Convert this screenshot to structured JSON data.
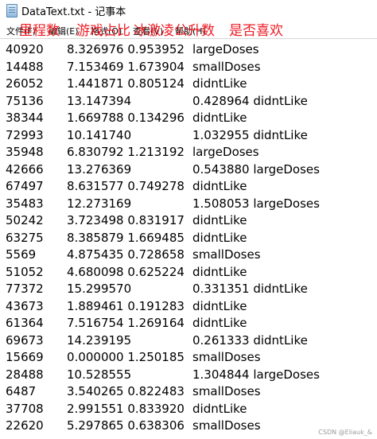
{
  "window": {
    "title": "DataText.txt - 记事本"
  },
  "menu": [
    "文件(F)",
    "编辑(E)",
    "格式(O)",
    "查看(V)",
    "帮助(H)"
  ],
  "annotations": [
    "里程数",
    "游戏占比",
    "冰激凌公升数",
    "是否喜欢"
  ],
  "rows": [
    [
      "40920",
      "8.326976 0.953952",
      "largeDoses"
    ],
    [
      "14488",
      "7.153469 1.673904",
      "smallDoses"
    ],
    [
      "26052",
      "1.441871 0.805124",
      "didntLike"
    ],
    [
      "75136",
      "13.147394",
      "0.428964 didntLike"
    ],
    [
      "38344",
      "1.669788 0.134296",
      "didntLike"
    ],
    [
      "72993",
      "10.141740",
      "1.032955 didntLike"
    ],
    [
      "35948",
      "6.830792 1.213192",
      "largeDoses"
    ],
    [
      "42666",
      "13.276369",
      "0.543880 largeDoses"
    ],
    [
      "67497",
      "8.631577 0.749278",
      "didntLike"
    ],
    [
      "35483",
      "12.273169",
      "1.508053 largeDoses"
    ],
    [
      "50242",
      "3.723498 0.831917",
      "didntLike"
    ],
    [
      "63275",
      "8.385879 1.669485",
      "didntLike"
    ],
    [
      "5569",
      "4.875435 0.728658",
      "smallDoses"
    ],
    [
      "51052",
      "4.680098 0.625224",
      "didntLike"
    ],
    [
      "77372",
      "15.299570",
      "0.331351 didntLike"
    ],
    [
      "43673",
      "1.889461 0.191283",
      "didntLike"
    ],
    [
      "61364",
      "7.516754 1.269164",
      "didntLike"
    ],
    [
      "69673",
      "14.239195",
      "0.261333 didntLike"
    ],
    [
      "15669",
      "0.000000 1.250185",
      "smallDoses"
    ],
    [
      "28488",
      "10.528555",
      "1.304844 largeDoses"
    ],
    [
      "6487",
      "3.540265 0.822483",
      "smallDoses"
    ],
    [
      "37708",
      "2.991551 0.833920",
      "didntLike"
    ],
    [
      "22620",
      "5.297865 0.638306",
      "smallDoses"
    ]
  ],
  "watermark": "CSDN @Eliauk_&"
}
